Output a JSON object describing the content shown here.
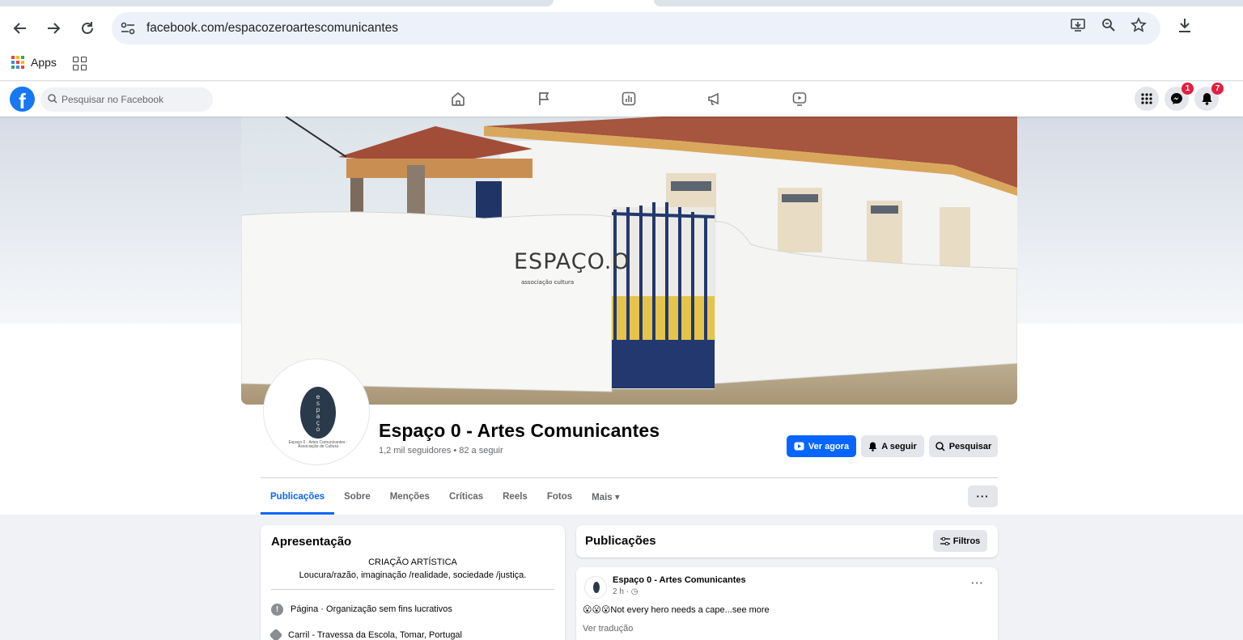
{
  "browser": {
    "url": "facebook.com/espacozeroartescomunicantes",
    "bookmarks": {
      "apps_label": "Apps"
    }
  },
  "facebook": {
    "search_placeholder": "Pesquisar no Facebook",
    "messenger_badge": "1",
    "notifications_badge": "7"
  },
  "page": {
    "cover_wall_text": "ESPAÇO.O",
    "cover_wall_subtext": "associação cultura",
    "avatar_logo_text": "espaço zero",
    "avatar_caption": "Espaço 0 · Artes Comunicantes · Associação de Cultura",
    "name": "Espaço 0 - Artes Comunicantes",
    "stats": "1,2 mil seguidores • 82 a seguir",
    "buttons": {
      "watch": "Ver agora",
      "following": "A seguir",
      "search": "Pesquisar"
    },
    "tabs": [
      {
        "label": "Publicações"
      },
      {
        "label": "Sobre"
      },
      {
        "label": "Menções"
      },
      {
        "label": "Críticas"
      },
      {
        "label": "Reels"
      },
      {
        "label": "Fotos"
      },
      {
        "label": "Mais ▾"
      }
    ],
    "more_button": "···"
  },
  "intro": {
    "title": "Apresentação",
    "bio_line1": "CRIAÇÃO ARTÍSTICA",
    "bio_line2": "Loucura/razão, imaginação /realidade, sociedade /justiça.",
    "category": "Página · Organização sem fins lucrativos",
    "address": "Carril - Travessa da Escola, Tomar, Portugal"
  },
  "posts": {
    "title": "Publicações",
    "filter_label": "Filtros",
    "items": [
      {
        "author": "Espaço 0 - Artes Comunicantes",
        "meta": "2 h · ◷",
        "text": "😮😮😮Not every hero needs a cape...see more",
        "translate": "Ver tradução"
      }
    ]
  }
}
